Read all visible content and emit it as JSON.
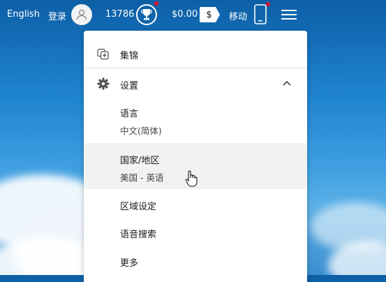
{
  "topbar": {
    "language": "English",
    "login": "登录",
    "points": "13786",
    "balance": "$0.00",
    "dollar_symbol": "$",
    "mobile": "移动",
    "notification_color": "#e5112d"
  },
  "menu": {
    "collections": "集锦",
    "settings": "设置",
    "language_label": "语言",
    "language_value": "中文(简体)",
    "region_label": "国家/地区",
    "region_value": "美国 - 英语",
    "locale_settings": "区域设定",
    "voice_search": "语音搜索",
    "more": "更多"
  },
  "icons": {
    "avatar": "user-icon",
    "rewards": "trophy-icon",
    "wallet": "dollar-tag-icon",
    "phone": "phone-icon",
    "menu": "hamburger-icon",
    "collections": "collections-icon",
    "settings": "gear-icon",
    "collapse": "chevron-up-icon",
    "cursor": "hand-pointer-icon"
  }
}
